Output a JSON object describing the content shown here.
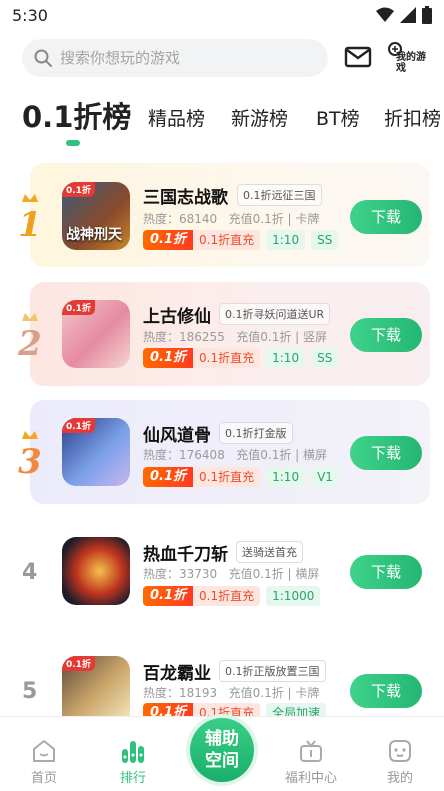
{
  "status": {
    "time": "5:30"
  },
  "search": {
    "placeholder": "搜索你想玩的游戏"
  },
  "header": {
    "my_games_label": "我的游戏"
  },
  "tabs": [
    "0.1折榜",
    "精品榜",
    "新游榜",
    "BT榜",
    "折扣榜"
  ],
  "games": [
    {
      "rank": "1",
      "title": "三国志战歌",
      "subtitle": "0.1折远征三国",
      "heat_label": "热度：",
      "heat": "68140",
      "recharge": "充值0.1折 | 卡牌",
      "discount": "0.1折",
      "discount_note": "0.1折直充",
      "tags": [
        "1:10",
        "SS"
      ],
      "icon_tag": "0.1折",
      "icon_text": "战神刑天",
      "button": "下载"
    },
    {
      "rank": "2",
      "title": "上古修仙",
      "subtitle": "0.1折寻妖问道送UR",
      "heat_label": "热度：",
      "heat": "186255",
      "recharge": "充值0.1折 | 竖屏",
      "discount": "0.1折",
      "discount_note": "0.1折直充",
      "tags": [
        "1:10",
        "SS"
      ],
      "icon_tag": "0.1折",
      "icon_text": "",
      "button": "下载"
    },
    {
      "rank": "3",
      "title": "仙风道骨",
      "subtitle": "0.1折打金版",
      "heat_label": "热度：",
      "heat": "176408",
      "recharge": "充值0.1折 | 横屏",
      "discount": "0.1折",
      "discount_note": "0.1折直充",
      "tags": [
        "1:10",
        "V1"
      ],
      "icon_tag": "0.1折",
      "icon_text": "",
      "button": "下载"
    },
    {
      "rank": "4",
      "title": "热血千刀斩",
      "subtitle": "送骑送首充",
      "heat_label": "热度：",
      "heat": "33730",
      "recharge": "充值0.1折 | 横屏",
      "discount": "0.1折",
      "discount_note": "0.1折直充",
      "tags": [
        "1:1000"
      ],
      "icon_tag": "",
      "icon_text": "",
      "button": "下载"
    },
    {
      "rank": "5",
      "title": "百龙霸业",
      "subtitle": "0.1折正版放置三国",
      "heat_label": "热度：",
      "heat": "18193",
      "recharge": "充值0.1折 | 卡牌",
      "discount": "0.1折",
      "discount_note": "0.1折直充",
      "tags": [
        "全局加速"
      ],
      "icon_tag": "0.1折",
      "icon_text": "",
      "button": "下载"
    }
  ],
  "nav": {
    "home": "首页",
    "rank": "排行",
    "center": "辅助空间",
    "welfare": "福利中心",
    "mine": "我的"
  },
  "colors": {
    "accent": "#2ec27e",
    "discount": "#ff4a1f",
    "gold": "#f5a623"
  }
}
